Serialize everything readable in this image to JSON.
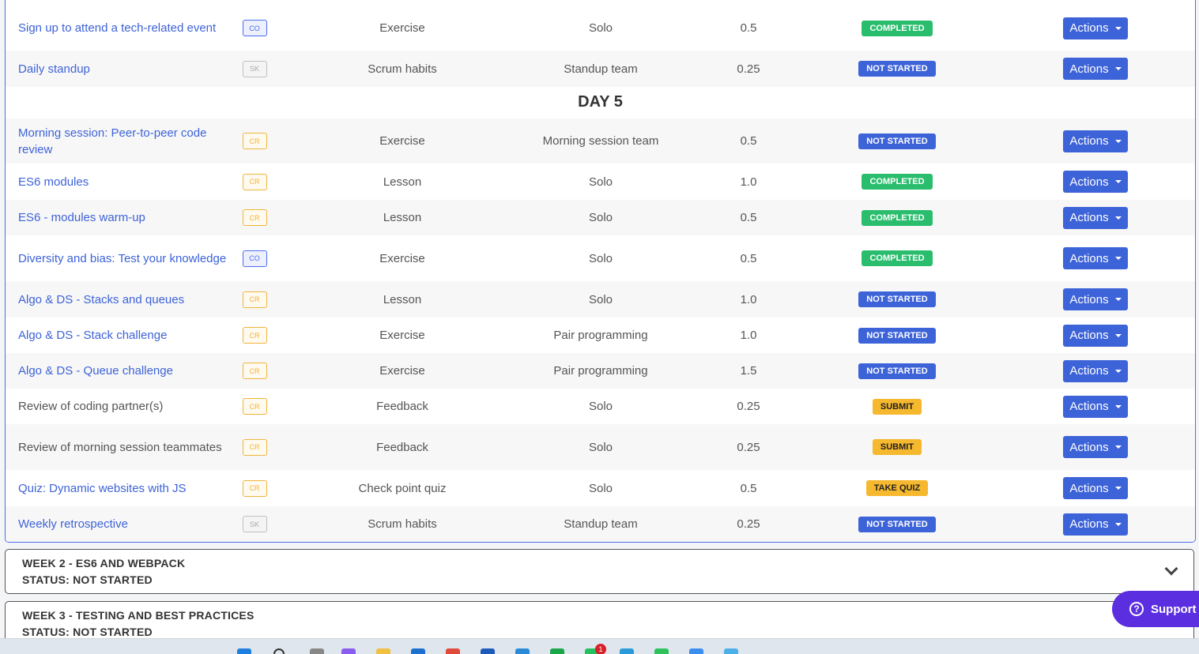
{
  "day_heading": "DAY 5",
  "action_label": "Actions",
  "rows_before": [
    {
      "title": "Sign up to attend a tech-related event",
      "title_style": "link",
      "tag": "CO",
      "type": "Exercise",
      "group": "Solo",
      "hours": "0.5",
      "status": "COMPLETED"
    },
    {
      "title": "Daily standup",
      "title_style": "link",
      "tag": "SK",
      "type": "Scrum habits",
      "group": "Standup team",
      "hours": "0.25",
      "status": "NOT STARTED"
    }
  ],
  "rows_after": [
    {
      "title": "Morning session: Peer-to-peer code review",
      "title_style": "link",
      "tag": "CR",
      "type": "Exercise",
      "group": "Morning session team",
      "hours": "0.5",
      "status": "NOT STARTED"
    },
    {
      "title": "ES6 modules",
      "title_style": "link",
      "tag": "CR",
      "type": "Lesson",
      "group": "Solo",
      "hours": "1.0",
      "status": "COMPLETED"
    },
    {
      "title": "ES6 - modules warm-up",
      "title_style": "link",
      "tag": "CR",
      "type": "Lesson",
      "group": "Solo",
      "hours": "0.5",
      "status": "COMPLETED"
    },
    {
      "title": "Diversity and bias: Test your knowledge",
      "title_style": "link",
      "tag": "CO",
      "type": "Exercise",
      "group": "Solo",
      "hours": "0.5",
      "status": "COMPLETED"
    },
    {
      "title": "Algo & DS - Stacks and queues",
      "title_style": "link",
      "tag": "CR",
      "type": "Lesson",
      "group": "Solo",
      "hours": "1.0",
      "status": "NOT STARTED"
    },
    {
      "title": "Algo & DS - Stack challenge",
      "title_style": "link",
      "tag": "CR",
      "type": "Exercise",
      "group": "Pair programming",
      "hours": "1.0",
      "status": "NOT STARTED"
    },
    {
      "title": "Algo & DS - Queue challenge",
      "title_style": "link",
      "tag": "CR",
      "type": "Exercise",
      "group": "Pair programming",
      "hours": "1.5",
      "status": "NOT STARTED"
    },
    {
      "title": "Review of coding partner(s)",
      "title_style": "plain",
      "tag": "CR",
      "type": "Feedback",
      "group": "Solo",
      "hours": "0.25",
      "status": "SUBMIT"
    },
    {
      "title": "Review of morning session teammates",
      "title_style": "plain",
      "tag": "CR",
      "type": "Feedback",
      "group": "Solo",
      "hours": "0.25",
      "status": "SUBMIT"
    },
    {
      "title": "Quiz: Dynamic websites with JS",
      "title_style": "link",
      "tag": "CR",
      "type": "Check point quiz",
      "group": "Solo",
      "hours": "0.5",
      "status": "TAKE QUIZ"
    },
    {
      "title": "Weekly retrospective",
      "title_style": "link",
      "tag": "SK",
      "type": "Scrum habits",
      "group": "Standup team",
      "hours": "0.25",
      "status": "NOT STARTED"
    }
  ],
  "weeks": [
    {
      "title": "WEEK 2 - ES6 AND WEBPACK",
      "status": "STATUS: NOT STARTED"
    },
    {
      "title": "WEEK 3 - TESTING AND BEST PRACTICES",
      "status": "STATUS: NOT STARTED"
    }
  ],
  "support_label": "Support",
  "notification_count": "1",
  "colors": {
    "accent": "#3d63d8",
    "completed": "#2bbd6e",
    "submit": "#f5b82e",
    "support": "#5b2ee0"
  }
}
